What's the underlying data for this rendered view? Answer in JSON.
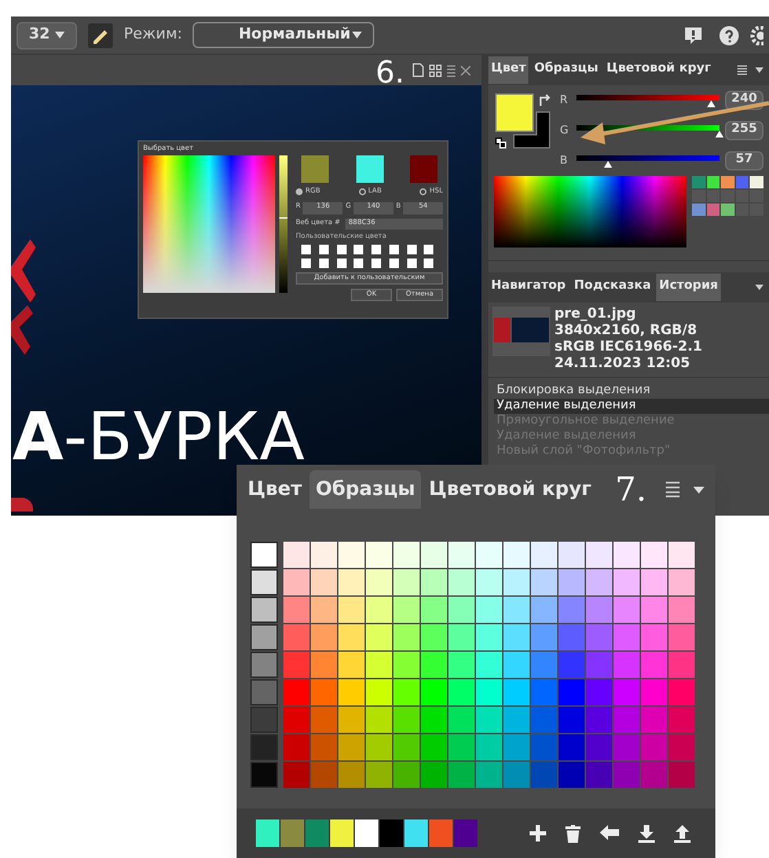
{
  "toolbar": {
    "brush_size": "32",
    "mode_label": "Режим:",
    "mode_value": "Нормальный"
  },
  "step_labels": [
    "6.",
    "7."
  ],
  "canvas": {
    "headline": "**А**-БУРКА"
  },
  "color_dialog": {
    "title": "Выбрать цвет",
    "brightness": {
      "level": 0.55
    },
    "swatches": [
      {
        "color": "#8a8a30"
      },
      {
        "color": "#40f0e0"
      },
      {
        "color": "#700000"
      }
    ],
    "modes": [
      {
        "label": "RGB",
        "selected": true
      },
      {
        "label": "LAB",
        "selected": false
      },
      {
        "label": "HSL",
        "selected": false
      }
    ],
    "fields": [
      {
        "label": "R",
        "value": "136"
      },
      {
        "label": "G",
        "value": "140"
      },
      {
        "label": "B",
        "value": "54"
      }
    ],
    "web_label": "Веб цвета #",
    "web_value": "888C36",
    "custom_label": "Пользовательские цвета",
    "add_button": "Добавить к пользовательским",
    "ok": "OK",
    "cancel": "Отмена"
  },
  "color_panel": {
    "tabs": [
      {
        "label": "Цвет",
        "selected": true
      },
      {
        "label": "Образцы",
        "selected": false
      },
      {
        "label": "Цветовой круг",
        "selected": false
      }
    ],
    "foreground": {
      "color": "#f5f53a"
    },
    "background": {
      "color": "#000000"
    },
    "channels": [
      {
        "name": "R",
        "level": 0.94,
        "value": "240"
      },
      {
        "name": "G",
        "level": 1,
        "value": "255"
      },
      {
        "name": "B",
        "level": 0.22,
        "value": "57"
      }
    ],
    "recent": [
      {
        "color": "#1e9070"
      },
      {
        "color": "#40e040"
      },
      {
        "color": "#f09050"
      },
      {
        "color": "#5060f0"
      },
      {
        "color": "#f0f0e0"
      },
      {
        "color": "#7090d0"
      },
      {
        "color": "#d06080"
      },
      {
        "color": "#70c070"
      }
    ]
  },
  "history_panel": {
    "tabs": [
      {
        "label": "Навигатор",
        "selected": false
      },
      {
        "label": "Подсказка",
        "selected": false
      },
      {
        "label": "История",
        "selected": true
      }
    ],
    "info": [
      "pre_01.jpg",
      "3840x2160, RGB/8",
      "sRGB IEC61966-2.1",
      "24.11.2023 12:05"
    ],
    "items": [
      {
        "label": "Блокировка выделения",
        "selected": false,
        "disabled": false
      },
      {
        "label": "Удаление выделения",
        "selected": true,
        "disabled": false
      },
      {
        "label": "Прямоугольное выделение",
        "selected": false,
        "disabled": true
      },
      {
        "label": "Удаление выделения",
        "selected": false,
        "disabled": true
      },
      {
        "label": "Новый слой \"Фотофильтр\"",
        "selected": false,
        "disabled": true
      }
    ]
  },
  "swatches_panel": {
    "tabs": [
      {
        "label": "Цвет",
        "selected": false
      },
      {
        "label": "Образцы",
        "selected": true
      },
      {
        "label": "Цветовой круг",
        "selected": false
      }
    ],
    "recent": [
      {
        "color": "#30f0c0"
      },
      {
        "color": "#8a8a40"
      },
      {
        "color": "#108a60"
      },
      {
        "color": "#f0f040"
      },
      {
        "color": "#ffffff"
      },
      {
        "color": "#000000"
      },
      {
        "color": "#40e0f0"
      },
      {
        "color": "#f05020"
      },
      {
        "color": "#500090"
      }
    ]
  }
}
